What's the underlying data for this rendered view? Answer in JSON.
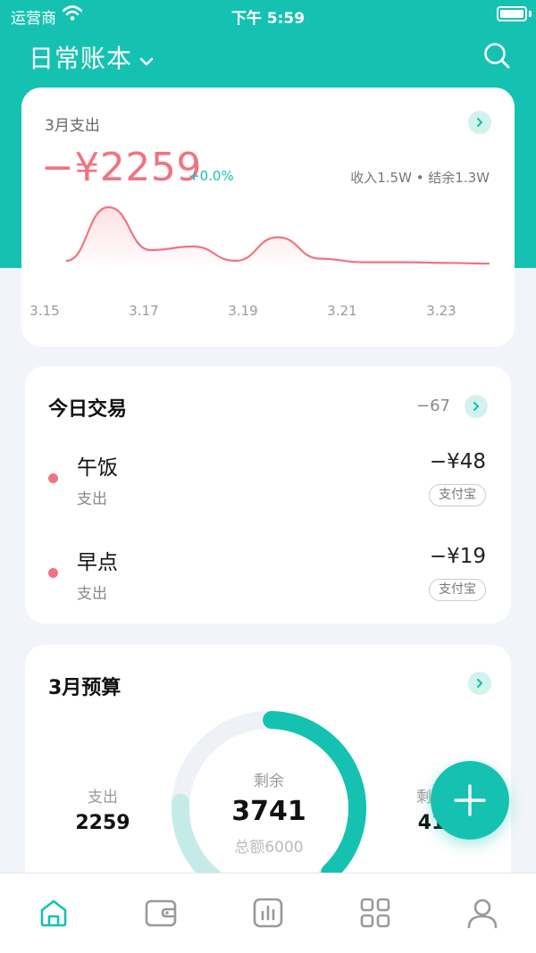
{
  "status_bar": {
    "carrier": "运营商",
    "time": "下午 5:59"
  },
  "header": {
    "book_name": "日常账本"
  },
  "month_card": {
    "label": "3月支出",
    "amount": "−¥2259",
    "change": "+0.0%",
    "summary": "收入1.5W • 结余1.3W"
  },
  "chart_data": {
    "type": "area",
    "x_labels": [
      "3.15",
      "3.17",
      "3.19",
      "3.21",
      "3.23"
    ],
    "series": [
      {
        "values": [
          5,
          80,
          20,
          25,
          5,
          38,
          8,
          3,
          3,
          2,
          1
        ]
      }
    ],
    "color": "#f07480"
  },
  "today": {
    "title": "今日交易",
    "total": "−67",
    "items": [
      {
        "name": "午饭",
        "type": "支出",
        "amount": "−¥48",
        "method": "支付宝"
      },
      {
        "name": "早点",
        "type": "支出",
        "amount": "−¥19",
        "method": "支付宝"
      }
    ]
  },
  "budget": {
    "title": "3月预算",
    "spent_label": "支出",
    "spent_value": "2259",
    "remaining_label": "剩余",
    "remaining_value": "3741",
    "total_text": "总额6000",
    "right_label": "剩余",
    "right_value": "41",
    "progress": 0.6235
  },
  "tabs": [
    {
      "name": "home",
      "icon": "home-icon",
      "active": true
    },
    {
      "name": "wallet",
      "icon": "wallet-icon"
    },
    {
      "name": "stats",
      "icon": "stats-icon"
    },
    {
      "name": "apps",
      "icon": "grid-icon"
    },
    {
      "name": "profile",
      "icon": "user-icon"
    }
  ],
  "colors": {
    "accent": "#15c2b1",
    "expense": "#f07480"
  }
}
